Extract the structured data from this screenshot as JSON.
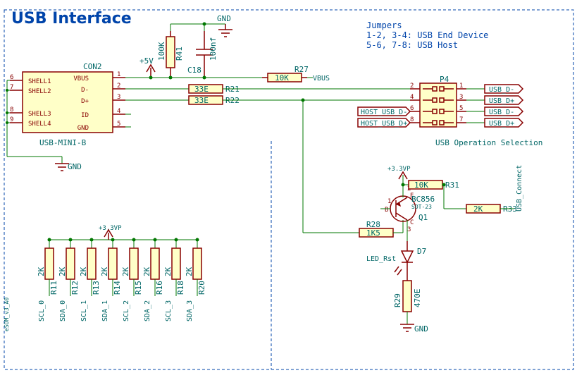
{
  "title": "USB Interface",
  "notes": {
    "l1": "Jumpers",
    "l2": "1-2, 3-4: USB End Device",
    "l3": "5-6, 7-8: USB Host"
  },
  "con2": {
    "ref": "CON2",
    "val": "USB-MINI-B",
    "pins": {
      "shell1": "SHELL1",
      "shell2": "SHELL2",
      "shell3": "SHELL3",
      "shell4": "SHELL4",
      "vbus": "VBUS",
      "dminus": "D-",
      "dplus": "D+",
      "id": "ID",
      "gnd": "GND",
      "n1": "1",
      "n2": "2",
      "n3": "3",
      "n4": "4",
      "n5": "5",
      "n6": "6",
      "n7": "7",
      "n8": "8",
      "n9": "9"
    }
  },
  "power": {
    "p5v": "+5V",
    "p3v3a": "+3.3VP",
    "p3v3b": "+3.3VP",
    "gnd1": "GND",
    "gnd2": "GND",
    "gnd3": "GND",
    "gnd4": "GND"
  },
  "c18": {
    "ref": "C18",
    "val": "100nf"
  },
  "r41": {
    "ref": "R41",
    "val": "100K"
  },
  "r21": {
    "ref": "R21",
    "val": "33E"
  },
  "r22": {
    "ref": "R22",
    "val": "33E"
  },
  "r27": {
    "ref": "R27",
    "val": "10K",
    "net": "VBUS"
  },
  "r31": {
    "ref": "R31",
    "val": "10K"
  },
  "r33": {
    "ref": "R33",
    "val": "2K"
  },
  "r28": {
    "ref": "R28",
    "val": "1K5"
  },
  "r29": {
    "ref": "R29",
    "val": "470E"
  },
  "d7": {
    "ref": "D7",
    "name": "LED_Rst"
  },
  "q1": {
    "ref": "Q1",
    "val": "BC856",
    "pkg": "SOT-23",
    "pb": "B",
    "pe": "E",
    "pc": "C",
    "p1": "1",
    "p2": "2",
    "p3": "3"
  },
  "p4": {
    "ref": "P4",
    "n1": "1",
    "n2": "2",
    "n3": "3",
    "n4": "4",
    "n5": "5",
    "n6": "6",
    "n7": "7",
    "n8": "8",
    "caption": "USB Operation Selection"
  },
  "netlabels": {
    "usb_dm_a": "USB_D-",
    "usb_dp_a": "USB_D+",
    "usb_dm_b": "USB_D-",
    "usb_dp_b": "USB_D+",
    "host_dm": "HOST_USB_D-",
    "host_dp": "HOST_USB_D+",
    "usb_conn": "USB_Connect"
  },
  "pullups": {
    "val": "2K",
    "items": [
      {
        "r": "R11",
        "sig": "SCL_0"
      },
      {
        "r": "R12",
        "sig": "SDA_0"
      },
      {
        "r": "R13",
        "sig": "SCL_1"
      },
      {
        "r": "R14",
        "sig": "SDA_1"
      },
      {
        "r": "R15",
        "sig": "SCL_2"
      },
      {
        "r": "R16",
        "sig": "SDA_2"
      },
      {
        "r": "R18",
        "sig": "SCL_3"
      },
      {
        "r": "R20",
        "sig": "SDA_3"
      }
    ]
  },
  "sidebar": "eSOM_v3_A0"
}
